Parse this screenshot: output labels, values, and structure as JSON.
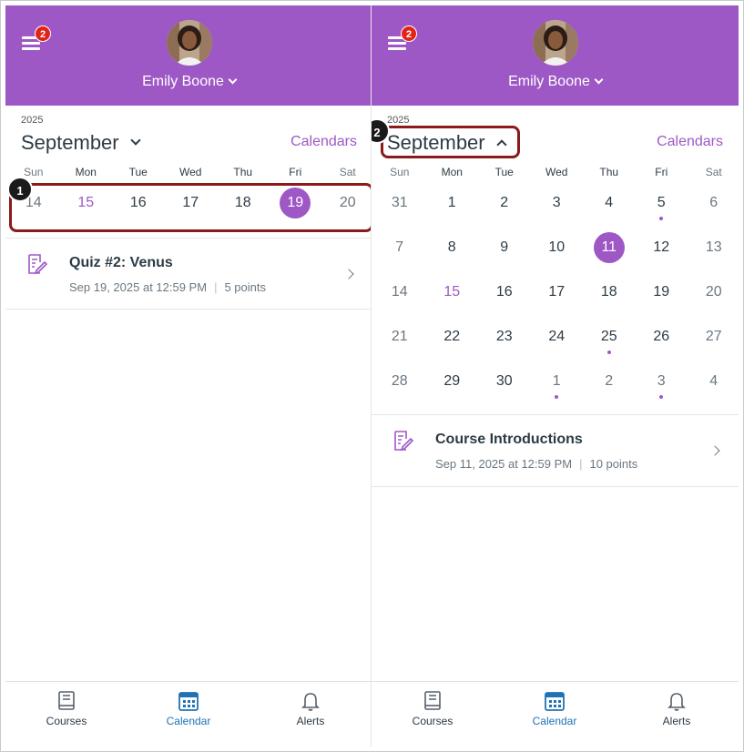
{
  "colors": {
    "brand": "#9e58c6",
    "callout": "#8b1a1a",
    "badge": "#e2231a",
    "active_tab": "#2172b4",
    "text": "#2d3b45"
  },
  "left": {
    "header": {
      "badge_count": "2",
      "user_name": "Emily Boone"
    },
    "year": "2025",
    "month": "September",
    "calendars_link": "Calendars",
    "weekdays": [
      "Sun",
      "Mon",
      "Tue",
      "Wed",
      "Thu",
      "Fri",
      "Sat"
    ],
    "week": [
      {
        "n": "14",
        "state": "muted"
      },
      {
        "n": "15",
        "state": "today"
      },
      {
        "n": "16",
        "state": ""
      },
      {
        "n": "17",
        "state": ""
      },
      {
        "n": "18",
        "state": ""
      },
      {
        "n": "19",
        "state": "selected"
      },
      {
        "n": "20",
        "state": "muted"
      }
    ],
    "callout": "1",
    "event": {
      "icon": "quiz-icon",
      "title": "Quiz #2: Venus",
      "date": "Sep 19, 2025 at 12:59 PM",
      "points": "5 points"
    }
  },
  "right": {
    "header": {
      "badge_count": "2",
      "user_name": "Emily Boone"
    },
    "year": "2025",
    "month": "September",
    "calendars_link": "Calendars",
    "weekdays": [
      "Sun",
      "Mon",
      "Tue",
      "Wed",
      "Thu",
      "Fri",
      "Sat"
    ],
    "weeks": [
      [
        {
          "n": "31",
          "state": "muted"
        },
        {
          "n": "1"
        },
        {
          "n": "2"
        },
        {
          "n": "3"
        },
        {
          "n": "4"
        },
        {
          "n": "5",
          "dot": true
        },
        {
          "n": "6",
          "state": "muted"
        }
      ],
      [
        {
          "n": "7",
          "state": "muted"
        },
        {
          "n": "8"
        },
        {
          "n": "9"
        },
        {
          "n": "10"
        },
        {
          "n": "11",
          "state": "selected"
        },
        {
          "n": "12"
        },
        {
          "n": "13",
          "state": "muted"
        }
      ],
      [
        {
          "n": "14",
          "state": "muted"
        },
        {
          "n": "15",
          "state": "today"
        },
        {
          "n": "16"
        },
        {
          "n": "17"
        },
        {
          "n": "18"
        },
        {
          "n": "19"
        },
        {
          "n": "20",
          "state": "muted"
        }
      ],
      [
        {
          "n": "21",
          "state": "muted"
        },
        {
          "n": "22"
        },
        {
          "n": "23"
        },
        {
          "n": "24"
        },
        {
          "n": "25",
          "dot": true
        },
        {
          "n": "26"
        },
        {
          "n": "27",
          "state": "muted"
        }
      ],
      [
        {
          "n": "28",
          "state": "muted"
        },
        {
          "n": "29"
        },
        {
          "n": "30"
        },
        {
          "n": "1",
          "state": "muted",
          "dot": true
        },
        {
          "n": "2",
          "state": "muted"
        },
        {
          "n": "3",
          "state": "muted",
          "dot": true
        },
        {
          "n": "4",
          "state": "muted"
        }
      ]
    ],
    "callout": "2",
    "event": {
      "icon": "assignment-icon",
      "title": "Course Introductions",
      "date": "Sep 11, 2025 at 12:59 PM",
      "points": "10 points"
    }
  },
  "tabs": [
    {
      "label": "Courses",
      "icon": "courses-icon",
      "active": false
    },
    {
      "label": "Calendar",
      "icon": "calendar-icon",
      "active": true
    },
    {
      "label": "Alerts",
      "icon": "bell-icon",
      "active": false
    }
  ]
}
